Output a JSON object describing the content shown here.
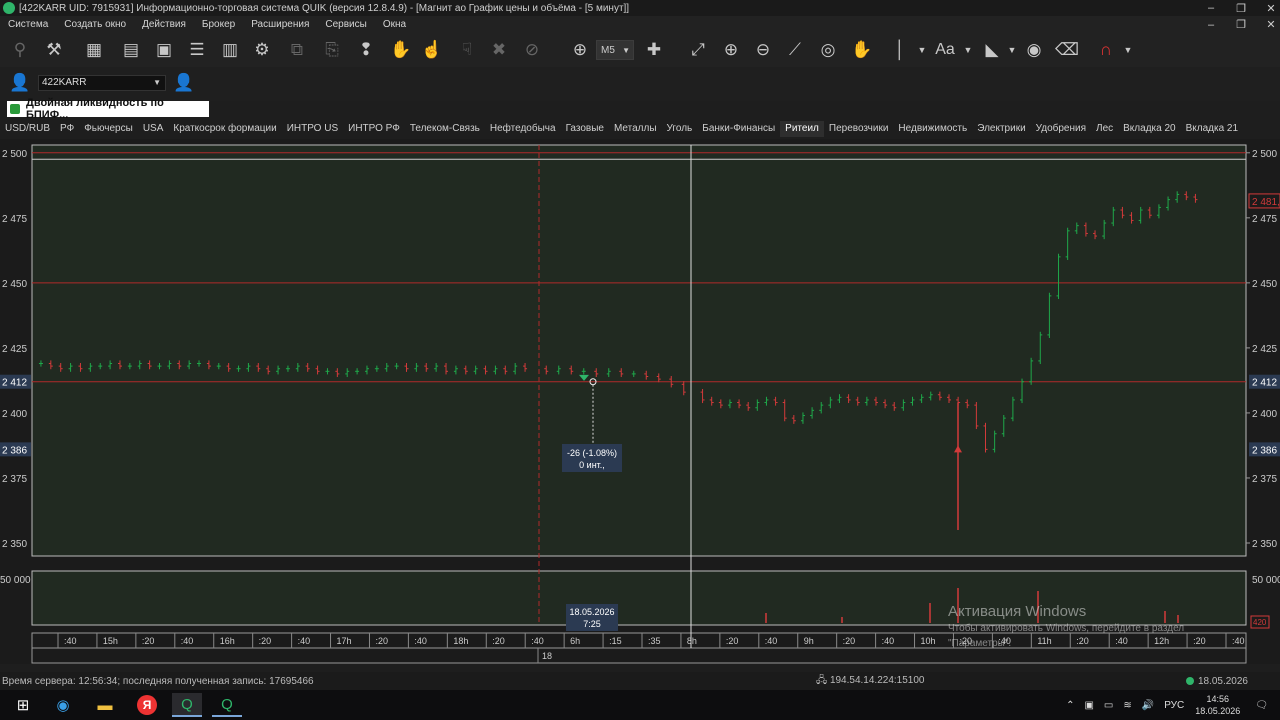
{
  "window": {
    "title": "[422KARR UID: 7915931] Информационно-торговая система QUIK (версия 12.8.4.9) - [Магнит ао График цены и объёма - [5 минут]]"
  },
  "menu": {
    "items": [
      "Система",
      "Создать окно",
      "Действия",
      "Брокер",
      "Расширения",
      "Сервисы",
      "Окна"
    ]
  },
  "toolbar": {
    "timeframe": "M5",
    "font_label": "Aa"
  },
  "account": {
    "value": "422KARR"
  },
  "strategy_label": "Двойная ликвидность по  БПИФ...",
  "tabs": {
    "items": [
      "USD/RUB",
      "РФ",
      "Фьючерсы",
      "USA",
      "Краткосрок формации",
      "ИНТРО US",
      "ИНТРО РФ",
      "Телеком-Связь",
      "Нефтедобыча",
      "Газовые",
      "Металлы",
      "Уголь",
      "Банки-Финансы",
      "Ритеил",
      "Перевозчики",
      "Недвижимость",
      "Электрики",
      "Удобрения",
      "Лес",
      "Вкладка 20",
      "Вкладка 21"
    ],
    "active_index": 13
  },
  "chart_data": {
    "type": "bar",
    "price_ticks": [
      "2 500",
      "2 475",
      "2 450",
      "2 425",
      "2 400",
      "2 375",
      "2 350"
    ],
    "price_tick_values": [
      2500,
      2475,
      2450,
      2425,
      2400,
      2375,
      2350
    ],
    "ylim": [
      2345,
      2503
    ],
    "left_markers": [
      {
        "label": "2 412",
        "value": 2412
      },
      {
        "label": "2 386",
        "value": 2386
      }
    ],
    "right_markers": [
      {
        "label": "2 412",
        "value": 2412
      },
      {
        "label": "2 386",
        "value": 2386
      },
      {
        "label": "2 481,5",
        "value": 2481.5
      }
    ],
    "horizontal_levels": [
      2500,
      2497.5,
      2450,
      2412
    ],
    "volume_ticks": [
      "50 000",
      "50 000"
    ],
    "volume_tag": "420",
    "time_axis_labels": [
      ":40",
      "15h",
      ":20",
      ":40",
      "16h",
      ":20",
      ":40",
      "17h",
      ":20",
      ":40",
      "18h",
      ":20",
      ":40",
      "6h",
      ":15",
      ":35",
      "8h",
      ":20",
      ":40",
      "9h",
      ":20",
      ":40",
      "10h",
      ":20",
      ":40",
      "11h",
      ":20",
      ":40",
      "12h",
      ":20",
      ":40"
    ],
    "date_axis_label": "18",
    "crosshair_date": "18.05.2026",
    "crosshair_time": "7:25",
    "measure_label_1": "-26 (-1.08%)",
    "measure_label_2": "0 инт.,",
    "series": [
      {
        "session": 1,
        "closes": [
          2419,
          2418,
          2417,
          2418,
          2417,
          2418,
          2418,
          2419,
          2418,
          2418,
          2419,
          2418,
          2418,
          2419,
          2418,
          2419,
          2419,
          2418,
          2418,
          2417,
          2417,
          2418,
          2417,
          2416,
          2417,
          2417,
          2418,
          2417,
          2416,
          2416,
          2415,
          2416,
          2416,
          2417,
          2417,
          2418,
          2418,
          2417,
          2418,
          2417,
          2418,
          2416,
          2417,
          2416,
          2417,
          2416,
          2417,
          2416,
          2418,
          2417
        ]
      },
      {
        "session": 2,
        "closes": [
          2416,
          2417,
          2416,
          2416,
          2415,
          2416,
          2415,
          2415,
          2414,
          2413,
          2411,
          2408
        ]
      },
      {
        "session": 3,
        "closes": [
          2405,
          2404,
          2403,
          2404,
          2403,
          2402,
          2404,
          2405,
          2404,
          2398,
          2397,
          2399,
          2401,
          2403,
          2405,
          2406,
          2405,
          2404,
          2405,
          2404,
          2403,
          2402,
          2404,
          2405,
          2406,
          2407,
          2406,
          2405,
          2404,
          2403,
          2395,
          2386,
          2392,
          2398,
          2405,
          2412,
          2420,
          2430,
          2445,
          2460,
          2470,
          2472,
          2469,
          2468,
          2473,
          2478,
          2476,
          2474,
          2478,
          2476,
          2479,
          2482,
          2484,
          2483,
          2482
        ]
      }
    ]
  },
  "status": {
    "left": "Время сервера: 12:56:34; последняя полученная запись: 17695466",
    "mid": "194.54.14.224:15100",
    "right": "18.05.2026"
  },
  "watermark": {
    "title": "Активация Windows",
    "line1": "Чтобы активировать Windows, перейдите в раздел",
    "line2": "\"Параметры\"."
  },
  "taskbar": {
    "lang": "РУС",
    "time": "14:56",
    "date": "18.05.2026"
  },
  "colors": {
    "chart_bg": "#212a21",
    "bull": "#1fa84a",
    "bear": "#d23a3a",
    "level_line": "#b02a2a",
    "accent_green": "#2fb56a"
  }
}
